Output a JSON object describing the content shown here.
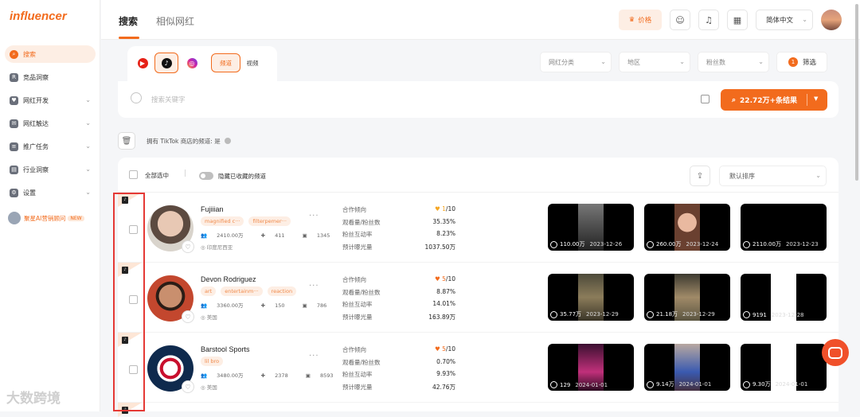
{
  "brand": {
    "logo_text": "influencer",
    "accent": "#f26b1d"
  },
  "sidebar": {
    "items": [
      {
        "label": "搜索",
        "icon": "search-icon",
        "active": true
      },
      {
        "label": "竞品洞察",
        "icon": "shield-icon"
      },
      {
        "label": "网红开发",
        "icon": "heart-icon",
        "chevron": true
      },
      {
        "label": "网红触达",
        "icon": "mail-icon",
        "chevron": true
      },
      {
        "label": "推广任务",
        "icon": "task-icon",
        "chevron": true
      },
      {
        "label": "行业洞察",
        "icon": "chart-icon",
        "chevron": true
      },
      {
        "label": "设置",
        "icon": "gear-icon",
        "chevron": true
      }
    ],
    "ai_label": "聚星AI营销顾问",
    "ai_badge": "NEW",
    "watermark": "大数跨境"
  },
  "header": {
    "tabs": [
      "搜索",
      "相似网红"
    ],
    "price_label": "价格",
    "lang": "简体中文"
  },
  "filters": {
    "platforms": [
      "youtube",
      "tiktok",
      "instagram"
    ],
    "mode_channel": "频道",
    "mode_video": "视频",
    "category": "网红分类",
    "region": "地区",
    "followers": "粉丝数",
    "screen_label": "筛选",
    "screen_count": "1"
  },
  "search": {
    "placeholder": "搜索关键字",
    "result_label": "22.72万+条结果"
  },
  "condition": {
    "text": "拥有 TikTok 商店的频道: 是"
  },
  "list": {
    "select_all": "全部选中",
    "hide_saved": "隐藏已收藏的频道",
    "sort": "默认排序",
    "metric_labels": [
      "合作倾向",
      "观看量/粉丝数",
      "粉丝互动率",
      "预计曝光量"
    ],
    "rows": [
      {
        "name": "Fujiiian",
        "tags": [
          "magnified c···",
          "filterpemer···"
        ],
        "followers": "2410.00万",
        "following": "411",
        "videos": "1345",
        "location": "印度尼西亚",
        "score": "1",
        "score_max": "/10",
        "views_ratio": "35.35%",
        "engagement": "8.23%",
        "exposure": "1037.50万",
        "videos_list": [
          {
            "views": "110.00万",
            "date": "2023-12-26"
          },
          {
            "views": "260.00万",
            "date": "2023-12-24"
          },
          {
            "views": "2110.00万",
            "date": "2023-12-23"
          }
        ]
      },
      {
        "name": "Devon Rodriguez",
        "tags": [
          "art",
          "entertainm···",
          "reaction"
        ],
        "followers": "3360.00万",
        "following": "150",
        "videos": "786",
        "location": "美国",
        "score": "5",
        "score_max": "/10",
        "views_ratio": "8.87%",
        "engagement": "14.01%",
        "exposure": "163.89万",
        "videos_list": [
          {
            "views": "35.77万",
            "date": "2023-12-29"
          },
          {
            "views": "21.18万",
            "date": "2023-12-29"
          },
          {
            "views": "9191",
            "date": "2023-12-28"
          }
        ]
      },
      {
        "name": "Barstool Sports",
        "tags": [
          "lil bro"
        ],
        "followers": "3480.00万",
        "following": "2378",
        "videos": "8593",
        "location": "美国",
        "score": "5",
        "score_max": "/10",
        "views_ratio": "0.70%",
        "engagement": "9.93%",
        "exposure": "42.76万",
        "videos_list": [
          {
            "views": "129",
            "date": "2024-01-01"
          },
          {
            "views": "9.14万",
            "date": "2024-01-01"
          },
          {
            "views": "9.30万",
            "date": "2024-01-01"
          }
        ]
      }
    ]
  }
}
